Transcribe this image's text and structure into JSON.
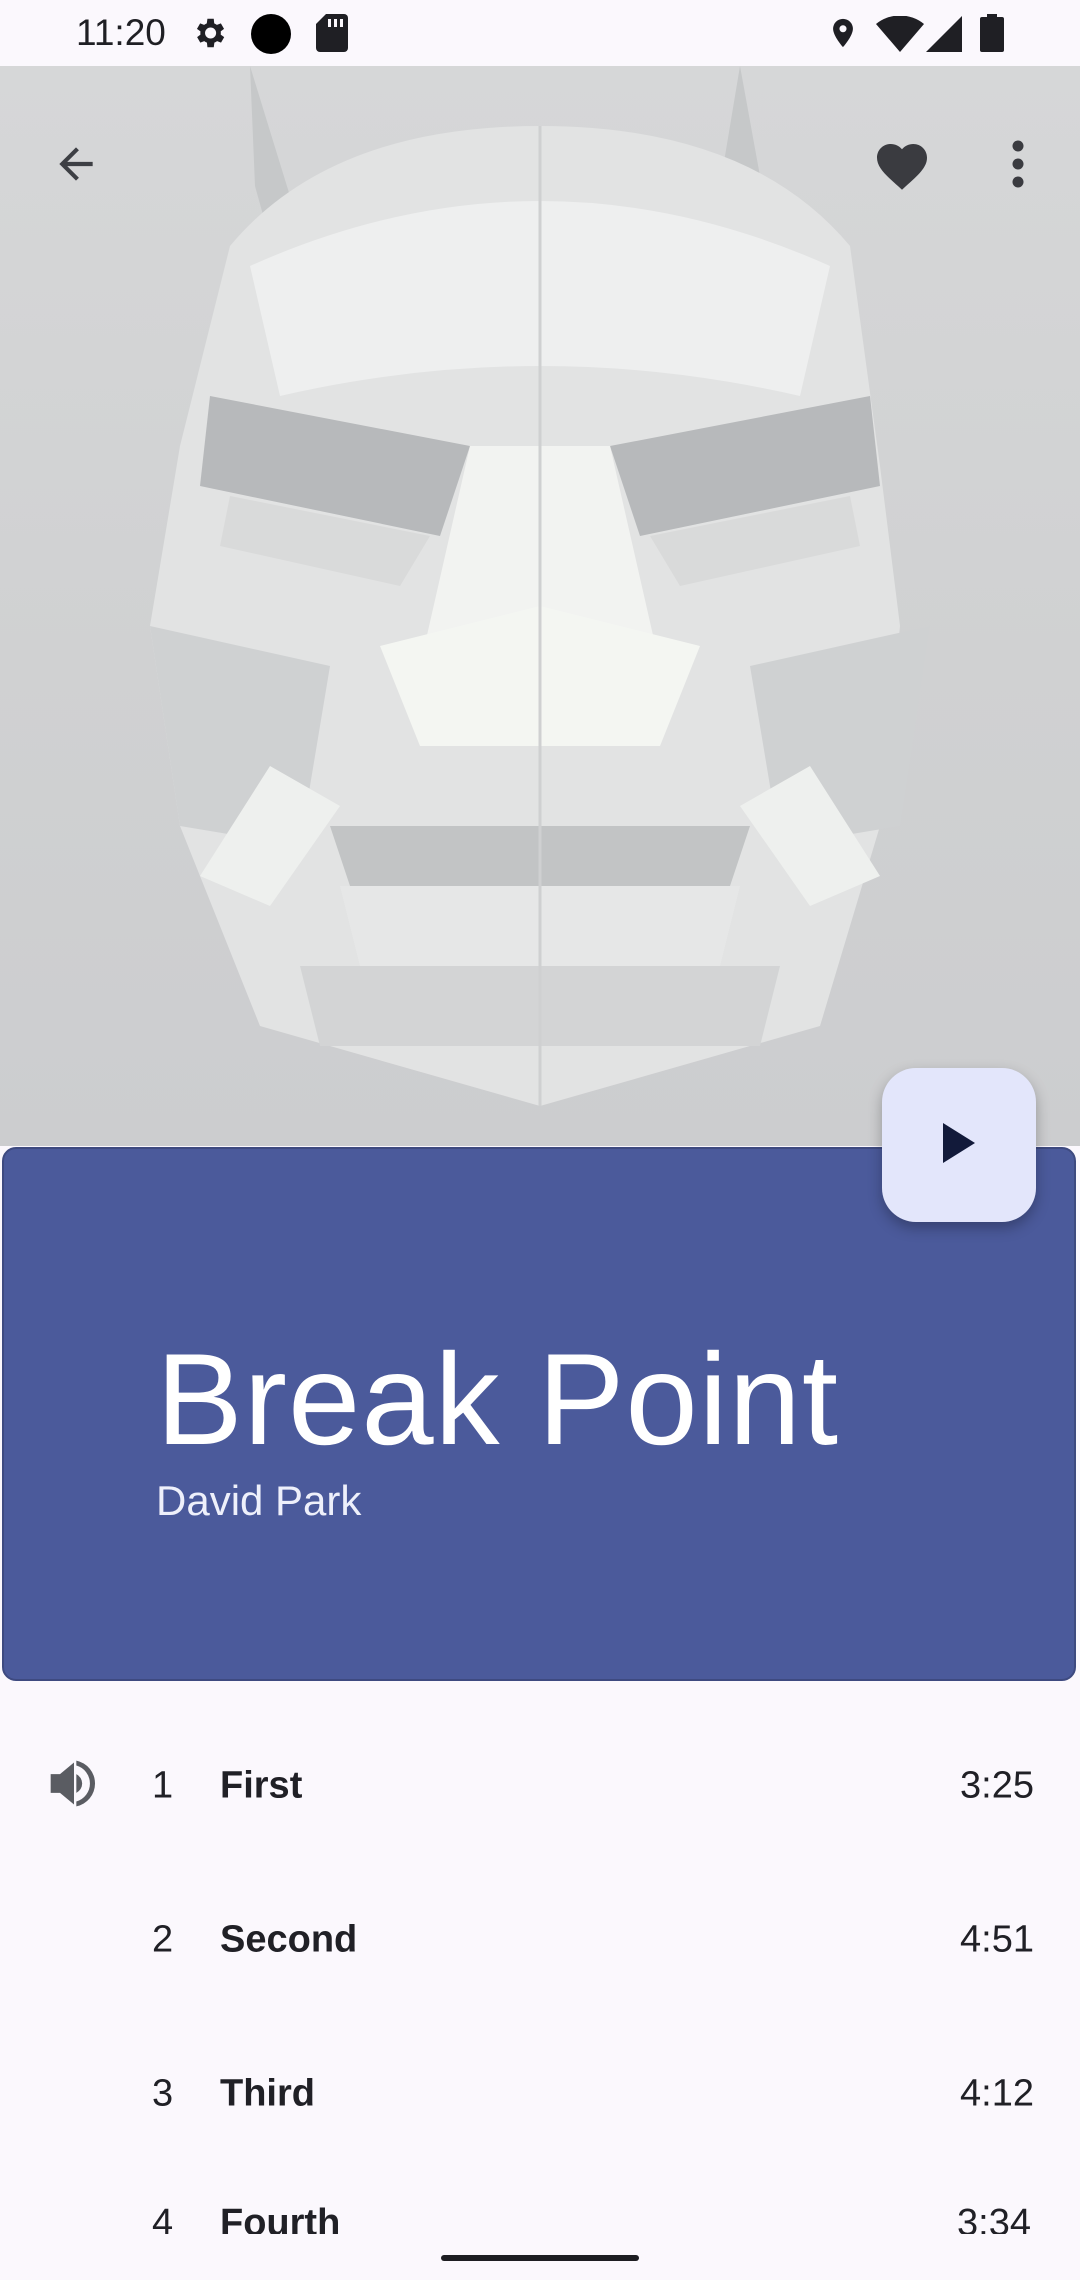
{
  "status_bar": {
    "time": "11:20",
    "icons": [
      "settings-icon",
      "dot-icon",
      "sd-card-icon",
      "location-icon",
      "wifi-icon",
      "signal-icon",
      "battery-icon"
    ]
  },
  "toolbar": {
    "back_icon": "arrow-back-icon",
    "favorite_icon": "heart-icon",
    "more_icon": "more-vert-icon"
  },
  "album": {
    "title": "Break Point",
    "artist": "David Park",
    "panel_color": "#4b5a9b"
  },
  "play_button": {
    "icon": "play-icon"
  },
  "tracks": [
    {
      "number": "1",
      "name": "First",
      "duration": "3:25",
      "playing": true
    },
    {
      "number": "2",
      "name": "Second",
      "duration": "4:51",
      "playing": false
    },
    {
      "number": "3",
      "name": "Third",
      "duration": "4:12",
      "playing": false
    },
    {
      "number": "4",
      "name": "Fourth",
      "duration": "3:34",
      "playing": false
    }
  ]
}
